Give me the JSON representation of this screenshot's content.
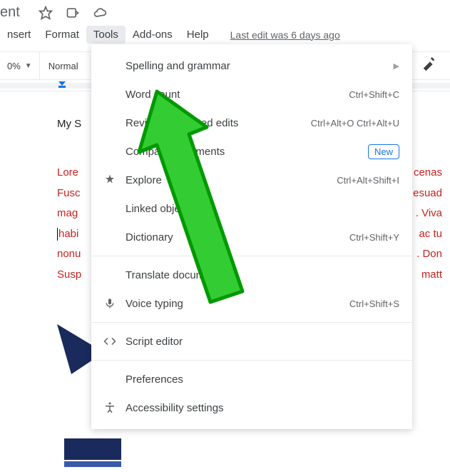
{
  "title_fragment": "ent",
  "menu": {
    "insert": "nsert",
    "format": "Format",
    "tools": "Tools",
    "addons": "Add-ons",
    "help": "Help",
    "last_edit": "Last edit was 6 days ago"
  },
  "toolbar": {
    "zoom": "0%",
    "style": "Normal"
  },
  "doc": {
    "heading": "My S",
    "lines_left": [
      "Lore",
      "Fusc",
      "mag",
      "habi",
      "nonu",
      "Susp"
    ],
    "lines_right": [
      "cenas",
      "esuad",
      ". Viva",
      "ac tu",
      ". Don",
      "matt"
    ]
  },
  "menu_items": {
    "spelling": "Spelling and grammar",
    "wordcount": "Word count",
    "wordcount_sc": "Ctrl+Shift+C",
    "review": "Review suggested edits",
    "review_sc": "Ctrl+Alt+O Ctrl+Alt+U",
    "compare": "Compare documents",
    "new_badge": "New",
    "explore": "Explore",
    "explore_sc": "Ctrl+Alt+Shift+I",
    "linked": "Linked objects",
    "dictionary": "Dictionary",
    "dictionary_sc": "Ctrl+Shift+Y",
    "translate": "Translate document",
    "voice": "Voice typing",
    "voice_sc": "Ctrl+Shift+S",
    "script": "Script editor",
    "prefs": "Preferences",
    "accessibility": "Accessibility settings"
  }
}
